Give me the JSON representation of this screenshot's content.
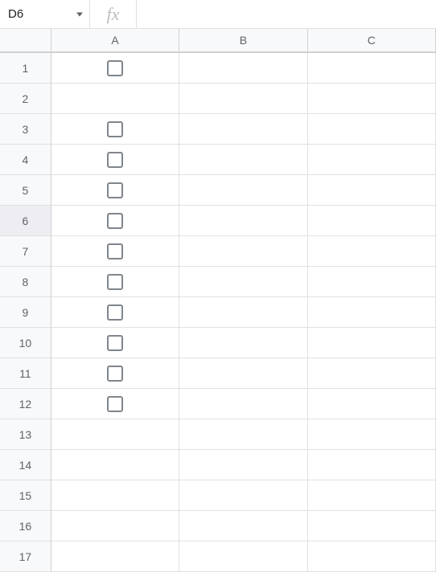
{
  "formula_bar": {
    "cell_reference": "D6",
    "fx_label": "fx",
    "formula_value": ""
  },
  "columns": [
    "A",
    "B",
    "C"
  ],
  "highlighted_row": 6,
  "rows": [
    {
      "num": 1,
      "checkbox": true
    },
    {
      "num": 2,
      "checkbox": false
    },
    {
      "num": 3,
      "checkbox": true
    },
    {
      "num": 4,
      "checkbox": true
    },
    {
      "num": 5,
      "checkbox": true
    },
    {
      "num": 6,
      "checkbox": true
    },
    {
      "num": 7,
      "checkbox": true
    },
    {
      "num": 8,
      "checkbox": true
    },
    {
      "num": 9,
      "checkbox": true
    },
    {
      "num": 10,
      "checkbox": true
    },
    {
      "num": 11,
      "checkbox": true
    },
    {
      "num": 12,
      "checkbox": true
    },
    {
      "num": 13,
      "checkbox": false
    },
    {
      "num": 14,
      "checkbox": false
    },
    {
      "num": 15,
      "checkbox": false
    },
    {
      "num": 16,
      "checkbox": false
    },
    {
      "num": 17,
      "checkbox": false
    }
  ]
}
